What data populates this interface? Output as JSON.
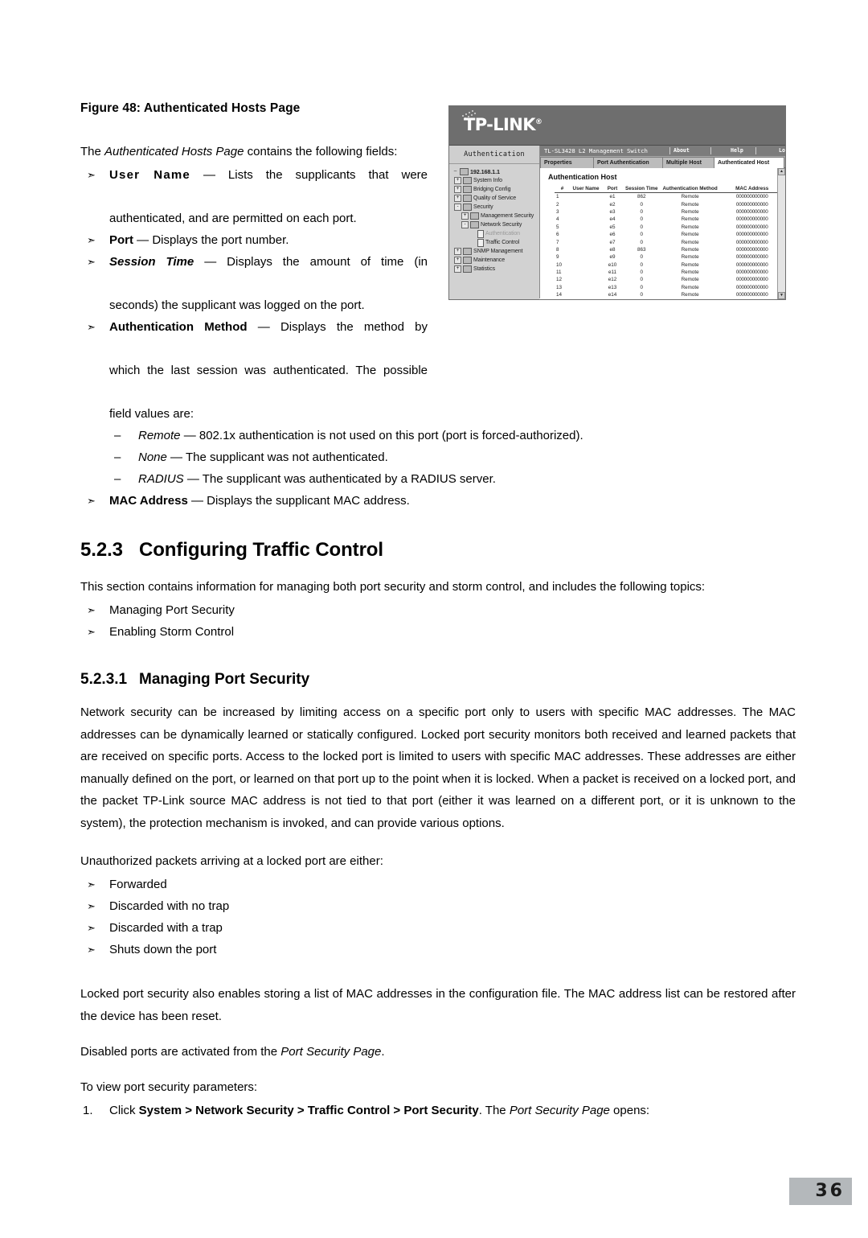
{
  "figure": {
    "caption": "Figure 48: Authenticated Hosts Page"
  },
  "intro": {
    "lead_pre": "The ",
    "lead_em": "Authenticated Hosts Page",
    "lead_post": " contains the following fields:"
  },
  "field_bullets": [
    {
      "term": "User Name",
      "dash": "—",
      "line1": "Lists the supplicants that were",
      "line2": "authenticated, and are permitted on each port."
    },
    {
      "term": "Port",
      "dash": "—",
      "line1": "Displays the port number."
    },
    {
      "term": "Session Time",
      "dash": "—",
      "line1": "Displays the amount of time (in",
      "line2": "seconds) the supplicant was logged on the port."
    },
    {
      "term": "Authentication Method",
      "dash": "—",
      "line1": "Displays the method by",
      "line2": "which the last session was authenticated. The possible",
      "line3": "field values are:"
    }
  ],
  "method_values": [
    {
      "term": "Remote",
      "dash": "—",
      "text": "802.1x authentication is not used on this port (port is forced-authorized)."
    },
    {
      "term": "None",
      "dash": "—",
      "text": "The supplicant was not authenticated."
    },
    {
      "term": "RADIUS",
      "dash": "—",
      "text": "The supplicant was authenticated by a RADIUS server."
    }
  ],
  "mac_bullet": {
    "term": "MAC Address",
    "dash": "—",
    "text": "Displays the supplicant MAC address."
  },
  "section": {
    "number": "5.2.3",
    "title": "Configuring Traffic Control",
    "intro": "This section contains information for managing both port security and storm control, and includes the following topics:",
    "topics": [
      "Managing Port Security",
      "Enabling Storm Control"
    ]
  },
  "subsection": {
    "number": "5.2.3.1",
    "title": "Managing Port Security",
    "para1": "Network security can be increased by limiting access on a specific port only to users with specific MAC addresses. The MAC addresses can be dynamically learned or statically configured. Locked port security monitors both received and learned packets that are received on specific ports. Access to the locked port is limited to users with specific MAC addresses. These addresses are either manually defined on the port, or learned on that port up to the point when it is locked. When a packet is received on a locked port, and the packet TP-Link source MAC address is not tied to that port (either it was learned on a different port, or it is unknown to the system), the protection mechanism is invoked, and can provide various options.",
    "para2": "Unauthorized packets arriving at a locked port are either:",
    "options": [
      "Forwarded",
      "Discarded with no trap",
      "Discarded with a trap",
      "Shuts down the port"
    ],
    "para3": "Locked port security also enables storing a list of MAC addresses in the configuration file. The MAC address list can be restored after the device has been reset.",
    "para4_pre": "Disabled ports are activated from the ",
    "para4_em": "Port Security Page",
    "para4_post": ".",
    "para5": "To view port security parameters:",
    "step1": {
      "number": "1.",
      "pre": "Click ",
      "bold_path": "System > Network Security > Traffic Control > Port Security",
      "mid": ". The ",
      "em": "Port Security Page",
      "post": " opens:"
    }
  },
  "screenshot": {
    "brand": "TP-LINK",
    "brand_mark": "®",
    "panel_label": "Authentication",
    "device_bar": {
      "model": "TL-SL3428 L2 Management Switch",
      "about": "About",
      "help": "Help",
      "logout": "Logout"
    },
    "tabs": [
      {
        "label": "Properties",
        "active": false
      },
      {
        "label": "Port Authentication",
        "active": false
      },
      {
        "label": "Multiple Host",
        "active": false
      },
      {
        "label": "Authenticated Host",
        "active": true
      }
    ],
    "tree": [
      {
        "label": "192.168.1.1",
        "depth": 0,
        "expander": "",
        "icon": "root",
        "root": true
      },
      {
        "label": "System Info",
        "depth": 1,
        "expander": "+",
        "icon": "folder"
      },
      {
        "label": "Bridging Config",
        "depth": 1,
        "expander": "+",
        "icon": "folder"
      },
      {
        "label": "Quality of Service",
        "depth": 1,
        "expander": "+",
        "icon": "folder"
      },
      {
        "label": "Security",
        "depth": 1,
        "expander": "-",
        "icon": "folder"
      },
      {
        "label": "Management Security",
        "depth": 2,
        "expander": "+",
        "icon": "folder"
      },
      {
        "label": "Network Security",
        "depth": 2,
        "expander": "-",
        "icon": "folder"
      },
      {
        "label": "Authentication",
        "depth": 3,
        "expander": "",
        "icon": "doc",
        "muted": true
      },
      {
        "label": "Traffic Control",
        "depth": 3,
        "expander": "",
        "icon": "doc"
      },
      {
        "label": "SNMP Management",
        "depth": 1,
        "expander": "+",
        "icon": "folder"
      },
      {
        "label": "Maintenance",
        "depth": 1,
        "expander": "+",
        "icon": "folder"
      },
      {
        "label": "Statistics",
        "depth": 1,
        "expander": "+",
        "icon": "folder"
      }
    ],
    "content_title": "Authentication Host",
    "table": {
      "columns": [
        "#",
        "User Name",
        "Port",
        "Session Time",
        "Authentication Method",
        "MAC Address"
      ],
      "rows": [
        [
          "1",
          "",
          "e1",
          "862",
          "Remote",
          "000000000000"
        ],
        [
          "2",
          "",
          "e2",
          "0",
          "Remote",
          "000000000000"
        ],
        [
          "3",
          "",
          "e3",
          "0",
          "Remote",
          "000000000000"
        ],
        [
          "4",
          "",
          "e4",
          "0",
          "Remote",
          "000000000000"
        ],
        [
          "5",
          "",
          "e5",
          "0",
          "Remote",
          "000000000000"
        ],
        [
          "6",
          "",
          "e6",
          "0",
          "Remote",
          "000000000000"
        ],
        [
          "7",
          "",
          "e7",
          "0",
          "Remote",
          "000000000000"
        ],
        [
          "8",
          "",
          "e8",
          "863",
          "Remote",
          "000000000000"
        ],
        [
          "9",
          "",
          "e9",
          "0",
          "Remote",
          "000000000000"
        ],
        [
          "10",
          "",
          "e10",
          "0",
          "Remote",
          "000000000000"
        ],
        [
          "11",
          "",
          "e11",
          "0",
          "Remote",
          "000000000000"
        ],
        [
          "12",
          "",
          "e12",
          "0",
          "Remote",
          "000000000000"
        ],
        [
          "13",
          "",
          "e13",
          "0",
          "Remote",
          "000000000000"
        ],
        [
          "14",
          "",
          "e14",
          "0",
          "Remote",
          "000000000000"
        ]
      ]
    },
    "scroll_up_icon": "▲",
    "scroll_down_icon": "▼"
  },
  "footer": {
    "page_number": "36"
  }
}
